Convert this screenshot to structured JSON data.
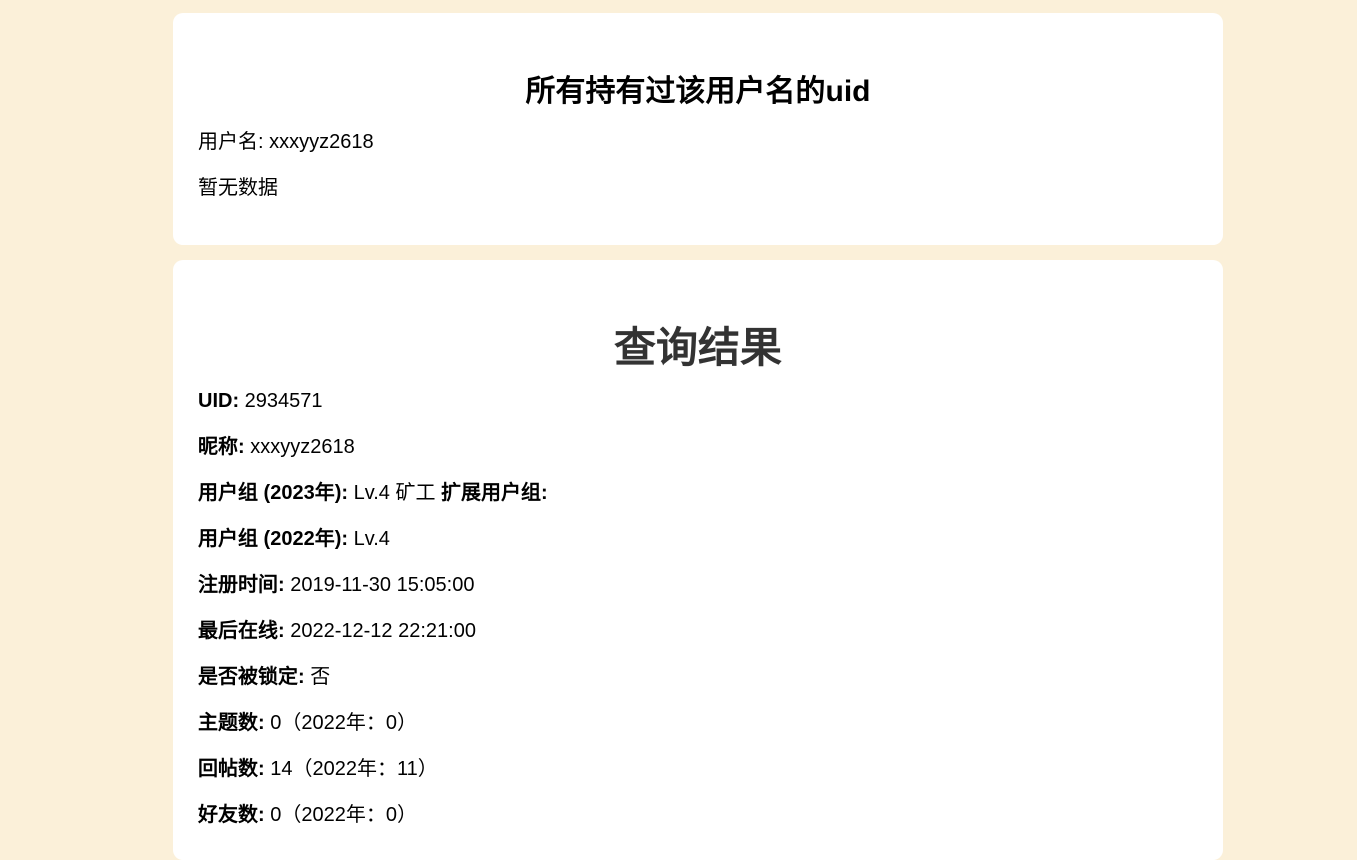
{
  "username_card": {
    "title": "所有持有过该用户名的uid",
    "username_label": "用户名:",
    "username_value": "xxxyyz2618",
    "empty_text": "暂无数据"
  },
  "result_card": {
    "title": "查询结果",
    "uid": {
      "label": "UID:",
      "value": "2934571"
    },
    "nickname": {
      "label": "昵称:",
      "value": "xxxyyz2618"
    },
    "group_2023": {
      "label": "用户组 (2023年):",
      "value": "Lv.4 矿工",
      "ext_label": "扩展用户组:"
    },
    "group_2022": {
      "label": "用户组 (2022年):",
      "value": "Lv.4"
    },
    "register_time": {
      "label": "注册时间:",
      "value": "2019-11-30 15:05:00"
    },
    "last_online": {
      "label": "最后在线:",
      "value": "2022-12-12 22:21:00"
    },
    "locked": {
      "label": "是否被锁定:",
      "value": "否"
    },
    "topics": {
      "label": "主题数:",
      "value": "0（2022年：0）"
    },
    "replies": {
      "label": "回帖数:",
      "value": "14（2022年：11）"
    },
    "friends": {
      "label": "好友数:",
      "value": "0（2022年：0）"
    }
  }
}
